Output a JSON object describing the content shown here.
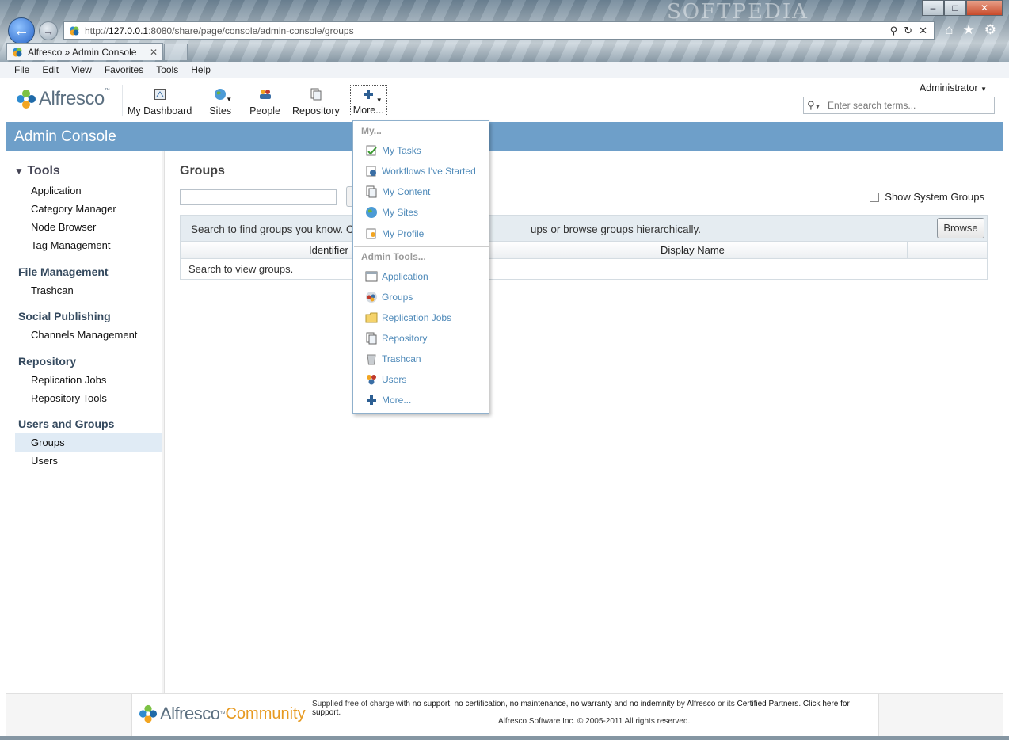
{
  "browser": {
    "watermark": "SOFTPEDIA",
    "url_prefix": "http://",
    "url_host": "127.0.0.1",
    "url_rest": ":8080/share/page/console/admin-console/groups",
    "tab_title": "Alfresco » Admin Console",
    "menu": [
      "File",
      "Edit",
      "View",
      "Favorites",
      "Tools",
      "Help"
    ]
  },
  "header": {
    "logo": "Alfresco",
    "nav": {
      "dashboard": "My Dashboard",
      "sites": "Sites",
      "people": "People",
      "repository": "Repository",
      "more": "More..."
    },
    "user": "Administrator",
    "search_placeholder": "Enter search terms..."
  },
  "page_title": "Admin Console",
  "sidebar": {
    "tools_label": "Tools",
    "tools_items": [
      "Application",
      "Category Manager",
      "Node Browser",
      "Tag Management"
    ],
    "file_management": "File Management",
    "file_items": [
      "Trashcan"
    ],
    "social_publishing": "Social Publishing",
    "social_items": [
      "Channels Management"
    ],
    "repository": "Repository",
    "repository_items": [
      "Replication Jobs",
      "Repository Tools"
    ],
    "users_and_groups": "Users and Groups",
    "users_items": [
      "Groups",
      "Users"
    ]
  },
  "main": {
    "title": "Groups",
    "show_system_groups": "Show System Groups",
    "info_text": "Search to find groups you know. Click ",
    "info_text_tail": "ups or browse groups hierarchically.",
    "browse_label": "Browse",
    "col_identifier": "Identifier",
    "col_display_name": "Display Name",
    "empty_text": "Search to view groups."
  },
  "dropdown": {
    "my_heading": "My...",
    "my_items": [
      "My Tasks",
      "Workflows I've Started",
      "My Content",
      "My Sites",
      "My Profile"
    ],
    "admin_heading": "Admin Tools...",
    "admin_items": [
      "Application",
      "Groups",
      "Replication Jobs",
      "Repository",
      "Trashcan",
      "Users",
      "More..."
    ]
  },
  "footer": {
    "logo_main": "Alfresco",
    "logo_sub": "Community",
    "notice_1": "Supplied free of charge with",
    "notice_2": "no support",
    "notice_3": ", ",
    "notice_4": "no certification",
    "notice_5": ", ",
    "notice_6": "no maintenance",
    "notice_7": ", ",
    "notice_8": "no warranty",
    "notice_9": " and ",
    "notice_10": "no indemnity",
    "notice_11": " by ",
    "notice_12": "Alfresco",
    "notice_13": " or its ",
    "notice_14": "Certified Partners",
    "notice_15": ". ",
    "notice_16": "Click here for support",
    "notice_17": ".",
    "copyright": "Alfresco Software Inc. © 2005-2011 All rights reserved."
  },
  "colors": {
    "title_bar": "#6e9fc9",
    "link_blue": "#4f8ab9",
    "active_item": "#e0ebf5"
  }
}
